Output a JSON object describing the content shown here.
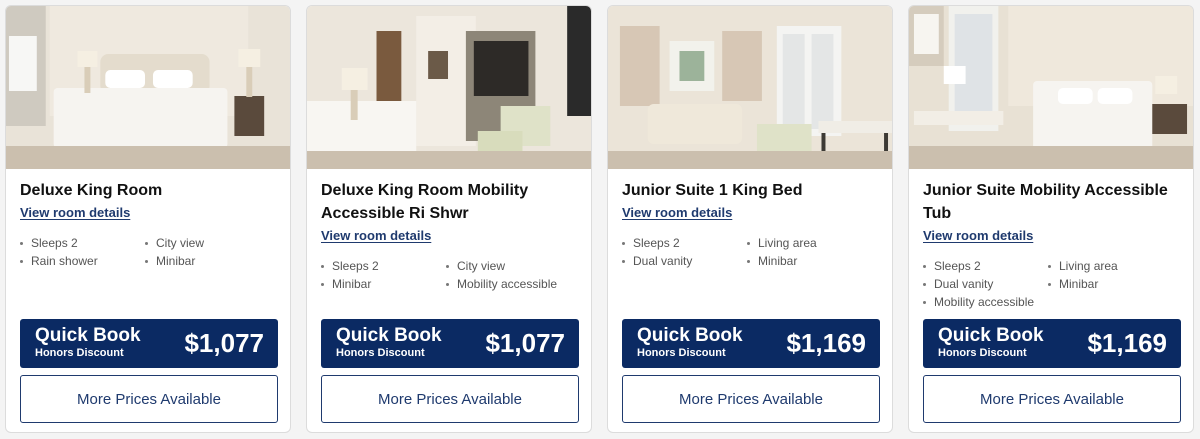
{
  "rooms": [
    {
      "title": "Deluxe King Room",
      "details_link": "View room details",
      "amenities": [
        "Sleeps 2",
        "City view",
        "Rain shower",
        "Minibar"
      ],
      "quick_book": {
        "line1": "Quick Book",
        "line2": "Honors Discount",
        "price": "$1,077"
      },
      "more_prices": "More Prices Available"
    },
    {
      "title": "Deluxe King Room Mobility Accessible Ri Shwr",
      "details_link": "View room details",
      "amenities": [
        "Sleeps 2",
        "City view",
        "Minibar",
        "Mobility accessible"
      ],
      "quick_book": {
        "line1": "Quick Book",
        "line2": "Honors Discount",
        "price": "$1,077"
      },
      "more_prices": "More Prices Available"
    },
    {
      "title": "Junior Suite 1 King Bed",
      "details_link": "View room details",
      "amenities": [
        "Sleeps 2",
        "Living area",
        "Dual vanity",
        "Minibar"
      ],
      "quick_book": {
        "line1": "Quick Book",
        "line2": "Honors Discount",
        "price": "$1,169"
      },
      "more_prices": "More Prices Available"
    },
    {
      "title": "Junior Suite Mobility Accessible Tub",
      "details_link": "View room details",
      "amenities": [
        "Sleeps 2",
        "Living area",
        "Dual vanity",
        "Minibar",
        "Mobility accessible"
      ],
      "quick_book": {
        "line1": "Quick Book",
        "line2": "Honors Discount",
        "price": "$1,169"
      },
      "more_prices": "More Prices Available"
    }
  ],
  "colors": {
    "brand_navy": "#0b2a63",
    "link_navy": "#1f3a6e",
    "card_bg": "#ffffff",
    "page_bg": "#f4f4f4"
  }
}
